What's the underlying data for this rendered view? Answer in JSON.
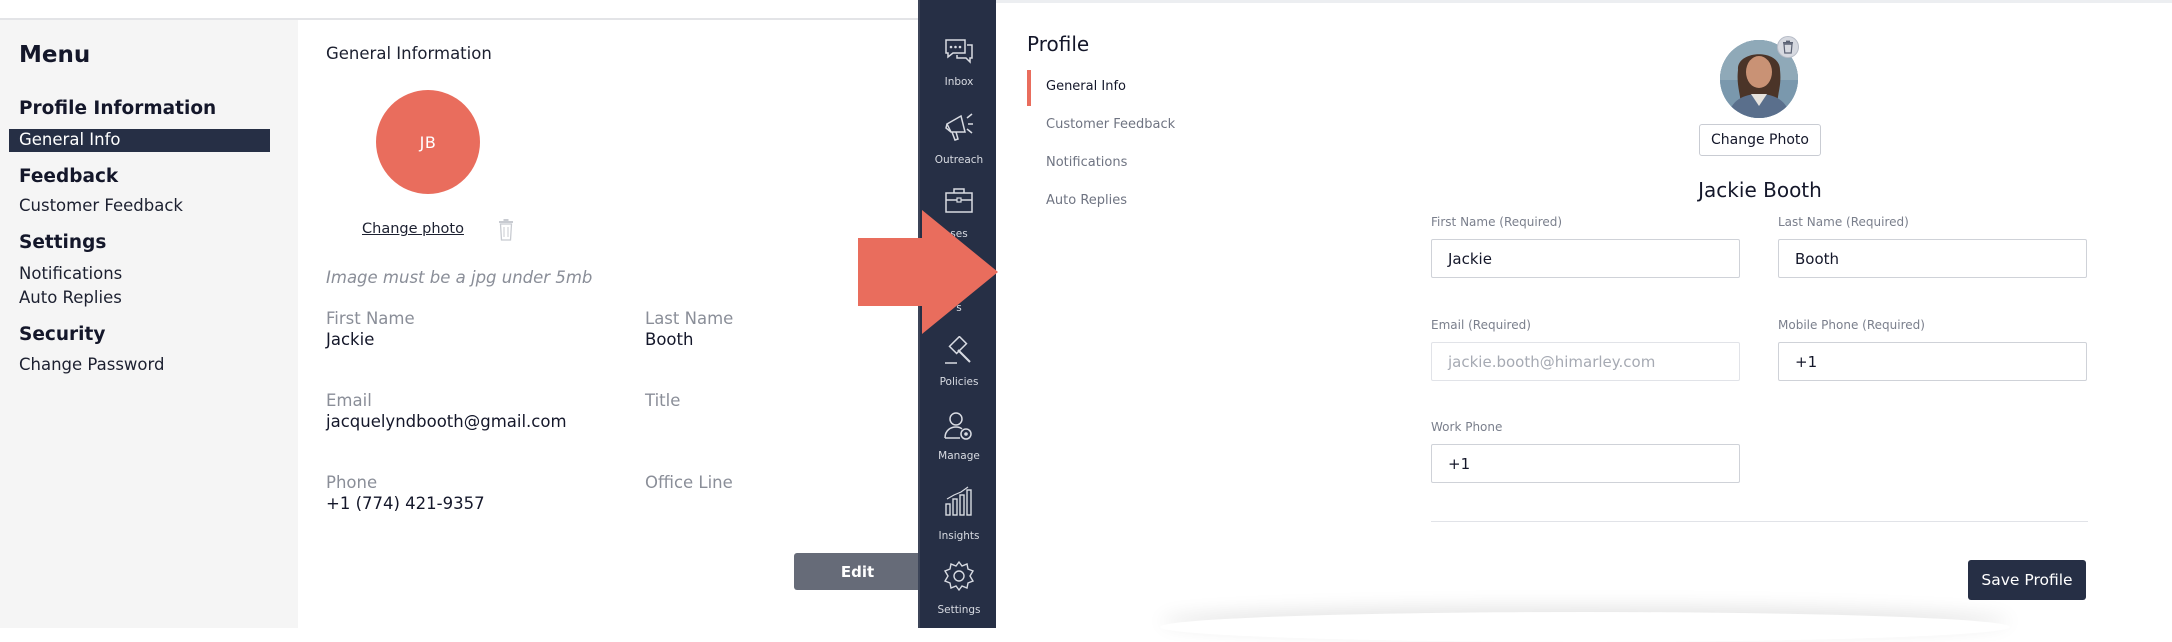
{
  "left": {
    "menu": {
      "title": "Menu",
      "sections": [
        {
          "heading": "Profile Information",
          "items": [
            "General Info"
          ]
        },
        {
          "heading": "Feedback",
          "items": [
            "Customer Feedback"
          ]
        },
        {
          "heading": "Settings",
          "items": [
            "Notifications",
            "Auto Replies"
          ]
        },
        {
          "heading": "Security",
          "items": [
            "Change Password"
          ]
        }
      ],
      "selected": "General Info"
    },
    "main": {
      "section_title": "General Information",
      "avatar_initials": "JB",
      "change_photo": "Change photo",
      "image_hint": "Image must be a jpg under 5mb",
      "fields": {
        "first_name": {
          "label": "First Name",
          "value": "Jackie"
        },
        "last_name": {
          "label": "Last Name",
          "value": "Booth"
        },
        "email": {
          "label": "Email",
          "value": "jacquelyndbooth@gmail.com"
        },
        "title": {
          "label": "Title",
          "value": ""
        },
        "phone": {
          "label": "Phone",
          "value": "+1 (774) 421-9357"
        },
        "office_line": {
          "label": "Office Line",
          "value": ""
        }
      },
      "edit_button": "Edit"
    }
  },
  "right": {
    "nav": [
      {
        "label": "Inbox",
        "icon": "inbox-icon"
      },
      {
        "label": "Outreach",
        "icon": "megaphone-icon"
      },
      {
        "label": "Cases",
        "icon": "briefcase-icon"
      },
      {
        "label": "Tasks",
        "icon": "tasks-icon"
      },
      {
        "label": "Policies",
        "icon": "gavel-icon"
      },
      {
        "label": "Manage",
        "icon": "user-gear-icon"
      },
      {
        "label": "Insights",
        "icon": "bar-chart-icon"
      },
      {
        "label": "Settings",
        "icon": "gear-icon"
      }
    ],
    "nav_visible_partial": {
      "cases": "ses",
      "tasks": "s"
    },
    "profile": {
      "title": "Profile",
      "subnav": [
        "General Info",
        "Customer Feedback",
        "Notifications",
        "Auto Replies"
      ],
      "active_subnav": "General Info",
      "change_photo_button": "Change Photo",
      "full_name": "Jackie Booth",
      "fields": {
        "first_name": {
          "label": "First Name (Required)",
          "value": "Jackie"
        },
        "last_name": {
          "label": "Last Name (Required)",
          "value": "Booth"
        },
        "email": {
          "label": "Email (Required)",
          "value": "jackie.booth@himarley.com"
        },
        "mobile_phone": {
          "label": "Mobile Phone (Required)",
          "value": "+1"
        },
        "work_phone": {
          "label": "Work Phone",
          "value": "+1"
        }
      },
      "save_button": "Save Profile"
    }
  },
  "colors": {
    "accent": "#e96d5d",
    "navy": "#262f45",
    "menu_bg": "#f5f5f5",
    "edit_button": "#666b78"
  }
}
